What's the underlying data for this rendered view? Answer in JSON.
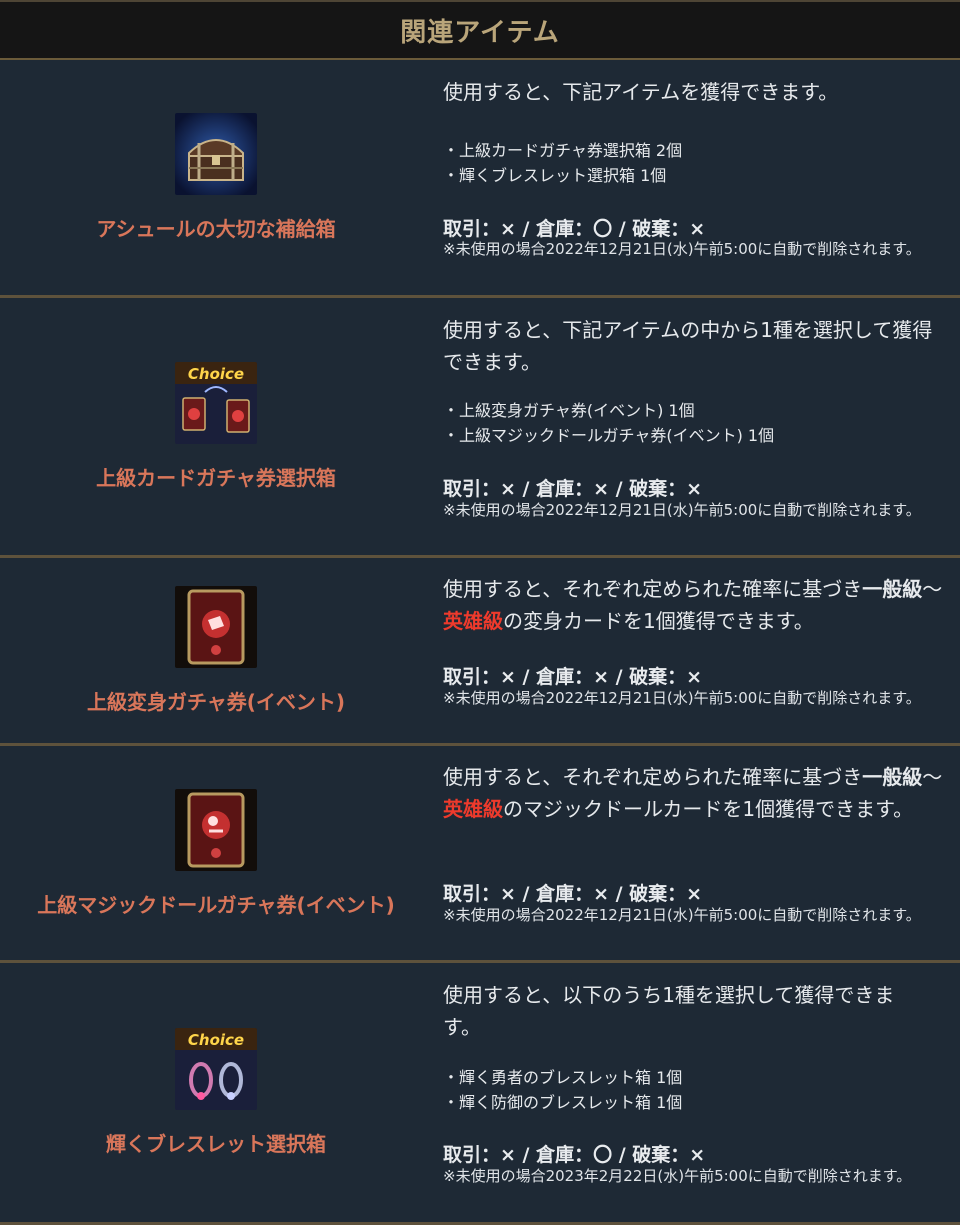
{
  "header": {
    "title": "関連アイテム"
  },
  "items": [
    {
      "name": "アシュールの大切な補給箱",
      "icon": "treasure-chest-icon",
      "desc": "使用すると、下記アイテムを獲得できます。",
      "contents": [
        "・上級カードガチャ券選択箱 2個",
        "・輝くブレスレット選択箱 1個"
      ],
      "trade": "取引：× / 倉庫：〇 / 破棄：×",
      "note": "※未使用の場合2022年12月21日(水)午前5:00に自動で削除されます。"
    },
    {
      "name": "上級カードガチャ券選択箱",
      "icon": "choice-card-box-icon",
      "icon_label": "Choice",
      "desc": "使用すると、下記アイテムの中から1種を選択して獲得できます。",
      "contents": [
        "・上級変身ガチャ券(イベント) 1個",
        "・上級マジックドールガチャ券(イベント) 1個"
      ],
      "trade": "取引：× / 倉庫：× / 破棄：×",
      "note": "※未使用の場合2022年12月21日(水)午前5:00に自動で削除されます。"
    },
    {
      "name": "上級変身ガチャ券(イベント)",
      "icon": "transform-card-icon",
      "desc_a": "使用すると、それぞれ定められた確率に基づき",
      "desc_b": "一般級",
      "desc_c": "～",
      "desc_d": "英雄級",
      "desc_e": "の変身カードを1個獲得できます。",
      "trade": "取引：× / 倉庫：× / 破棄：×",
      "note": "※未使用の場合2022年12月21日(水)午前5:00に自動で削除されます。"
    },
    {
      "name": "上級マジックドールガチャ券(イベント)",
      "icon": "magic-doll-card-icon",
      "desc_a": "使用すると、それぞれ定められた確率に基づき",
      "desc_b": "一般級",
      "desc_c": "～",
      "desc_d": "英雄級",
      "desc_e": "のマジックドールカードを1個獲得できます。",
      "trade": "取引：× / 倉庫：× / 破棄：×",
      "note": "※未使用の場合2022年12月21日(水)午前5:00に自動で削除されます。"
    },
    {
      "name": "輝くブレスレット選択箱",
      "icon": "choice-bracelet-box-icon",
      "icon_label": "Choice",
      "desc": "使用すると、以下のうち1種を選択して獲得できます。",
      "contents": [
        "・輝く勇者のブレスレット箱 1個",
        "・輝く防御のブレスレット箱 1個"
      ],
      "trade": "取引：× / 倉庫：〇 / 破棄：×",
      "note": "※未使用の場合2023年2月22日(水)午前5:00に自動で削除されます。"
    }
  ]
}
